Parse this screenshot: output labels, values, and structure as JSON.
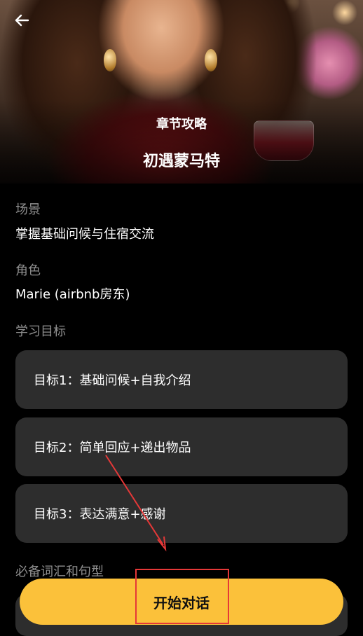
{
  "hero": {
    "subtitle": "章节攻略",
    "title": "初遇蒙马特"
  },
  "scene": {
    "label": "场景",
    "value": "掌握基础问候与住宿交流"
  },
  "role": {
    "label": "角色",
    "value": "Marie (airbnb房东)"
  },
  "goals": {
    "label": "学习目标",
    "items": [
      {
        "text": "目标1：基础问候+自我介绍"
      },
      {
        "text": "目标2：简单回应+递出物品"
      },
      {
        "text": "目标3：表达满意+感谢"
      }
    ]
  },
  "vocab": {
    "label": "必备词汇和句型"
  },
  "cta": {
    "label": "开始对话"
  },
  "icons": {
    "back": "arrow-left-icon"
  },
  "colors": {
    "accent": "#fbc13a",
    "card": "#2d2d2d",
    "annotation": "#e53838"
  }
}
